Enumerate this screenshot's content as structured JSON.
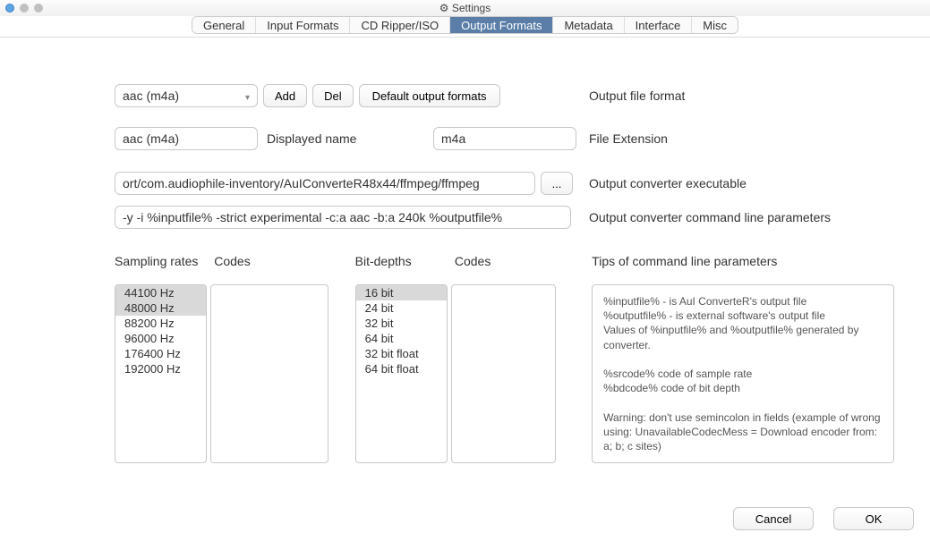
{
  "window": {
    "title": "Settings"
  },
  "tabs": [
    "General",
    "Input Formats",
    "CD Ripper/ISO",
    "Output Formats",
    "Metadata",
    "Interface",
    "Misc"
  ],
  "active_tab": "Output Formats",
  "top": {
    "format_combo": "aac (m4a)",
    "add_btn": "Add",
    "del_btn": "Del",
    "defaults_btn": "Default output formats",
    "label_format": "Output file format",
    "name_value": "aac (m4a)",
    "name_label": "Displayed name",
    "ext_value": "m4a",
    "ext_label": "File Extension",
    "exec_value": "ort/com.audiophile-inventory/AuIConverteR48x44/ffmpeg/ffmpeg",
    "browse_btn": "...",
    "exec_label": "Output converter executable",
    "cmd_value": "-y -i %inputfile% -strict experimental -c:a aac -b:a 240k %outputfile%",
    "cmd_label": "Output converter command line parameters"
  },
  "sampling": {
    "title": "Sampling rates",
    "codes_title": "Codes",
    "items": [
      "44100 Hz",
      "48000 Hz",
      "88200 Hz",
      "96000 Hz",
      "176400 Hz",
      "192000 Hz"
    ],
    "selected": [
      0,
      1
    ]
  },
  "bitdepth": {
    "title": "Bit-depths",
    "codes_title": "Codes",
    "items": [
      "16 bit",
      "24 bit",
      "32 bit",
      "64 bit",
      "32 bit float",
      "64 bit float"
    ],
    "selected": [
      0
    ]
  },
  "tips": {
    "title": "Tips of command line parameters",
    "body": "%inputfile% - is AuI ConverteR's output file\n%outputfile% - is external software's output file\nValues of %inputfile% and %outputfile% generated by converter.\n\n%srcode% code of sample rate\n%bdcode% code of bit depth\n\nWarning: don't use semincolon in fields (example of wrong using: UnavailableCodecMess = Download encoder from: a; b; c sites)"
  },
  "footer": {
    "cancel": "Cancel",
    "ok": "OK"
  }
}
